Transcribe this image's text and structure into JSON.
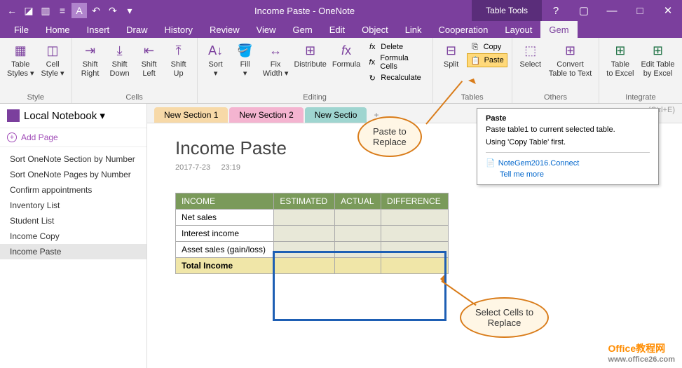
{
  "titlebar": {
    "title": "Income Paste - OneNote",
    "table_tools": "Table Tools"
  },
  "menubar": [
    "File",
    "Home",
    "Insert",
    "Draw",
    "History",
    "Review",
    "View",
    "Gem",
    "Edit",
    "Object",
    "Link",
    "Cooperation",
    "Layout",
    "Gem"
  ],
  "menubar_active_index": 13,
  "ribbon": {
    "style": {
      "label": "Style",
      "buttons": [
        {
          "label": "Table\nStyles ▾"
        },
        {
          "label": "Cell\nStyle ▾"
        }
      ]
    },
    "cells": {
      "label": "Cells",
      "buttons": [
        {
          "label": "Shift\nRight"
        },
        {
          "label": "Shift\nDown"
        },
        {
          "label": "Shift\nLeft"
        },
        {
          "label": "Shift\nUp"
        }
      ]
    },
    "editing": {
      "label": "Editing",
      "buttons": [
        {
          "label": "Sort\n▾"
        },
        {
          "label": "Fill\n▾"
        },
        {
          "label": "Fix\nWidth ▾"
        },
        {
          "label": "Distribute"
        },
        {
          "label": "Formula"
        }
      ],
      "small": [
        {
          "label": "Delete"
        },
        {
          "label": "Formula Cells"
        },
        {
          "label": "Recalculate"
        }
      ]
    },
    "tables": {
      "label": "Tables",
      "split": "Split",
      "copy": "Copy",
      "paste": "Paste"
    },
    "others": {
      "label": "Others",
      "buttons": [
        {
          "label": "Select"
        },
        {
          "label": "Convert\nTable to Text"
        }
      ]
    },
    "integrate": {
      "label": "Integrate",
      "buttons": [
        {
          "label": "Table\nto Excel"
        },
        {
          "label": "Edit Table\nby Excel"
        }
      ]
    }
  },
  "sidebar": {
    "notebook": "Local Notebook ▾",
    "addpage": "Add Page",
    "pages": [
      "Sort OneNote Section by Number",
      "Sort OneNote Pages by Number",
      "Confirm appointments",
      "Inventory List",
      "Student List",
      "Income Copy",
      "Income Paste"
    ],
    "selected_index": 6
  },
  "sections": {
    "tabs": [
      "New Section 1",
      "New Section 2",
      "New Sectio"
    ],
    "search": "(Ctrl+E)"
  },
  "page": {
    "title": "Income Paste",
    "date": "2017-7-23",
    "time": "23:19"
  },
  "table": {
    "headers": [
      "INCOME",
      "ESTIMATED",
      "ACTUAL",
      "DIFFERENCE"
    ],
    "rows": [
      [
        "Net sales",
        "",
        "",
        ""
      ],
      [
        "Interest income",
        "",
        "",
        ""
      ],
      [
        "Asset sales (gain/loss)",
        "",
        "",
        ""
      ]
    ],
    "total_row": [
      "Total Income",
      "",
      "",
      ""
    ]
  },
  "tooltip": {
    "title": "Paste",
    "body1": "Paste table1 to current selected table.",
    "body2": "Using 'Copy Table' first.",
    "link": "NoteGem2016.Connect",
    "tellme": "Tell me more"
  },
  "callouts": {
    "c1": "Paste to\nReplace",
    "c2": "Select Cells to\nReplace"
  },
  "watermark": {
    "brand": "Office教程网",
    "url": "www.office26.com"
  }
}
